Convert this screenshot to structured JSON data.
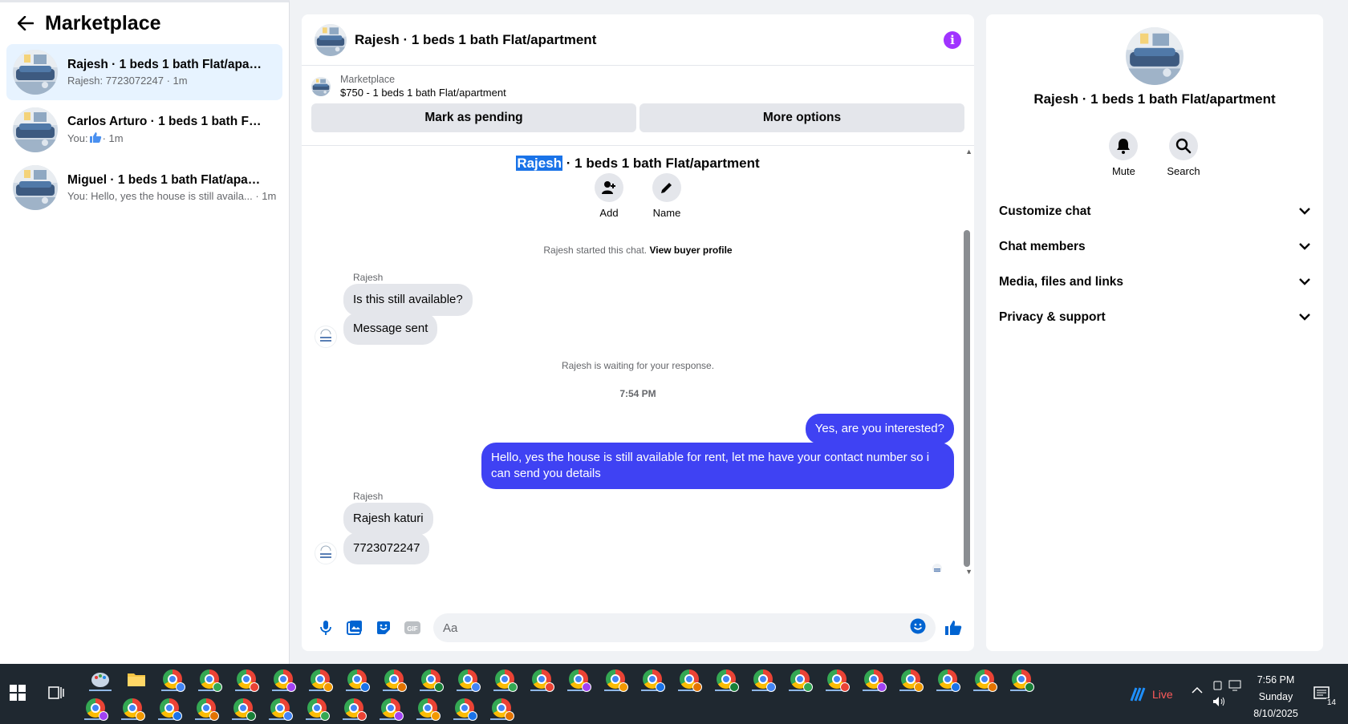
{
  "sidebar": {
    "title": "Marketplace",
    "conversations": [
      {
        "title": "Rajesh · 1 beds 1 bath Flat/apartm...",
        "sub": "Rajesh: 7723072247 · 1m"
      },
      {
        "title": "Carlos Arturo · 1 beds 1 bath Flat/a...",
        "sub_prefix": "You:",
        "sub_suffix": "· 1m"
      },
      {
        "title": "Miguel · 1 beds 1 bath Flat/apartm...",
        "sub": "You: Hello, yes the house is still availa... · 1m"
      }
    ]
  },
  "chat": {
    "header_title": "Rajesh · 1 beds 1 bath Flat/apartment",
    "listing": {
      "category": "Marketplace",
      "price_line": "$750 - 1 beds 1 bath Flat/apartment",
      "btn_pending": "Mark as pending",
      "btn_more": "More options"
    },
    "top_title_highlight": "Rajesh",
    "top_title_rest": " · 1 beds 1 bath Flat/apartment",
    "top_actions": {
      "add": "Add",
      "name": "Name"
    },
    "started_text": "Rajesh started this chat.",
    "view_profile": "View buyer profile",
    "sender1": "Rajesh",
    "msg1": "Is this still available?",
    "msg2": "Message sent",
    "waiting": "Rajesh is waiting for your response.",
    "time": "7:54 PM",
    "out1": "Yes, are you interested?",
    "out2": "Hello, yes the house is still available for rent, let me have your contact number so i can send you details",
    "sender2": "Rajesh",
    "msg3": "Rajesh katuri",
    "msg4": "7723072247",
    "composer_placeholder": "Aa"
  },
  "rpanel": {
    "title": "Rajesh · 1 beds 1 bath Flat/apartment",
    "mute": "Mute",
    "search": "Search",
    "rows": [
      "Customize chat",
      "Chat members",
      "Media, files and links",
      "Privacy & support"
    ]
  },
  "taskbar": {
    "live": "Live",
    "time": "7:56 PM",
    "day": "Sunday",
    "date": "8/10/2025",
    "notif_count": "14"
  },
  "colors": {
    "accent": "#0064d1",
    "outgoing": "#3f42f3",
    "info": "#a033ff",
    "active_conv": "#e7f3ff"
  }
}
